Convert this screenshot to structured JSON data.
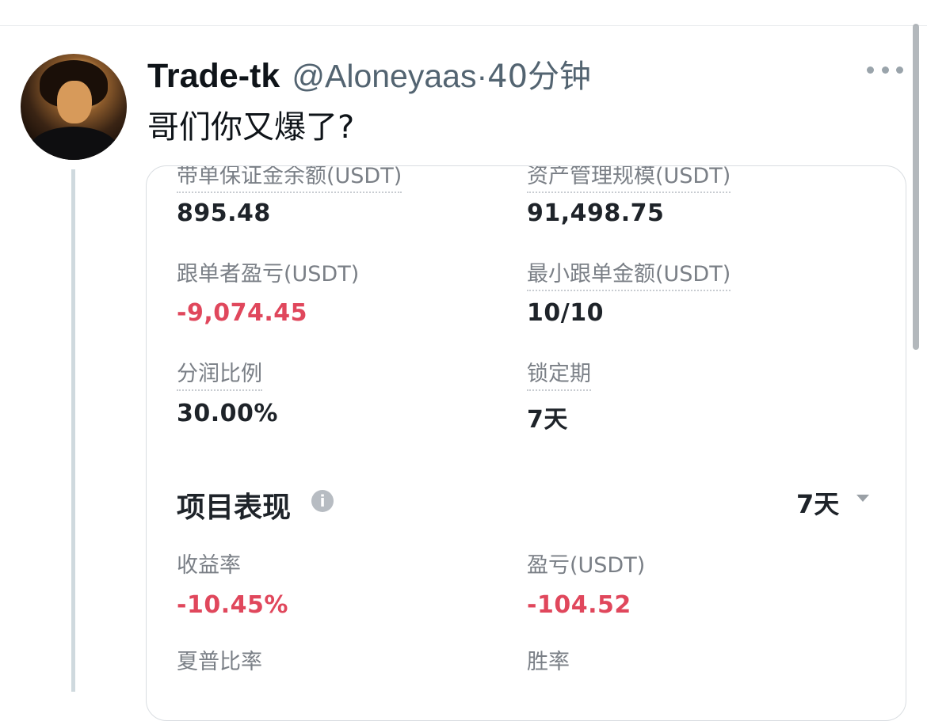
{
  "tweet": {
    "display_name": "Trade-tk",
    "handle": "@Aloneyaas",
    "separator": "·",
    "time": "40分钟",
    "text": "哥们你又爆了?"
  },
  "icons": {
    "more": "more-horizontal-icon",
    "info": "info-icon",
    "dropdown": "chevron-down-icon"
  },
  "card": {
    "fields": [
      {
        "label": "带单保证金余额(USDT)",
        "value": "895.48",
        "negative": false
      },
      {
        "label": "资产管理规模(USDT)",
        "value": "91,498.75",
        "negative": false
      },
      {
        "label": "跟单者盈亏(USDT)",
        "value": "-9,074.45",
        "negative": true
      },
      {
        "label": "最小跟单金额(USDT)",
        "value": "10/10",
        "negative": false
      },
      {
        "label": "分润比例",
        "value": "30.00%",
        "negative": false
      },
      {
        "label": "锁定期",
        "value": "7天",
        "negative": false
      }
    ],
    "section": {
      "title": "项目表现",
      "info_symbol": "i",
      "period": "7天",
      "metrics": [
        {
          "label": "收益率",
          "value": "-10.45%",
          "negative": true
        },
        {
          "label": "盈亏(USDT)",
          "value": "-104.52",
          "negative": true
        },
        {
          "label": "夏普比率",
          "value": "",
          "negative": false
        },
        {
          "label": "胜率",
          "value": "",
          "negative": false
        }
      ]
    }
  },
  "colors": {
    "negative": "#e0475c",
    "secondary_text": "#536471",
    "label": "#7a7f86"
  }
}
